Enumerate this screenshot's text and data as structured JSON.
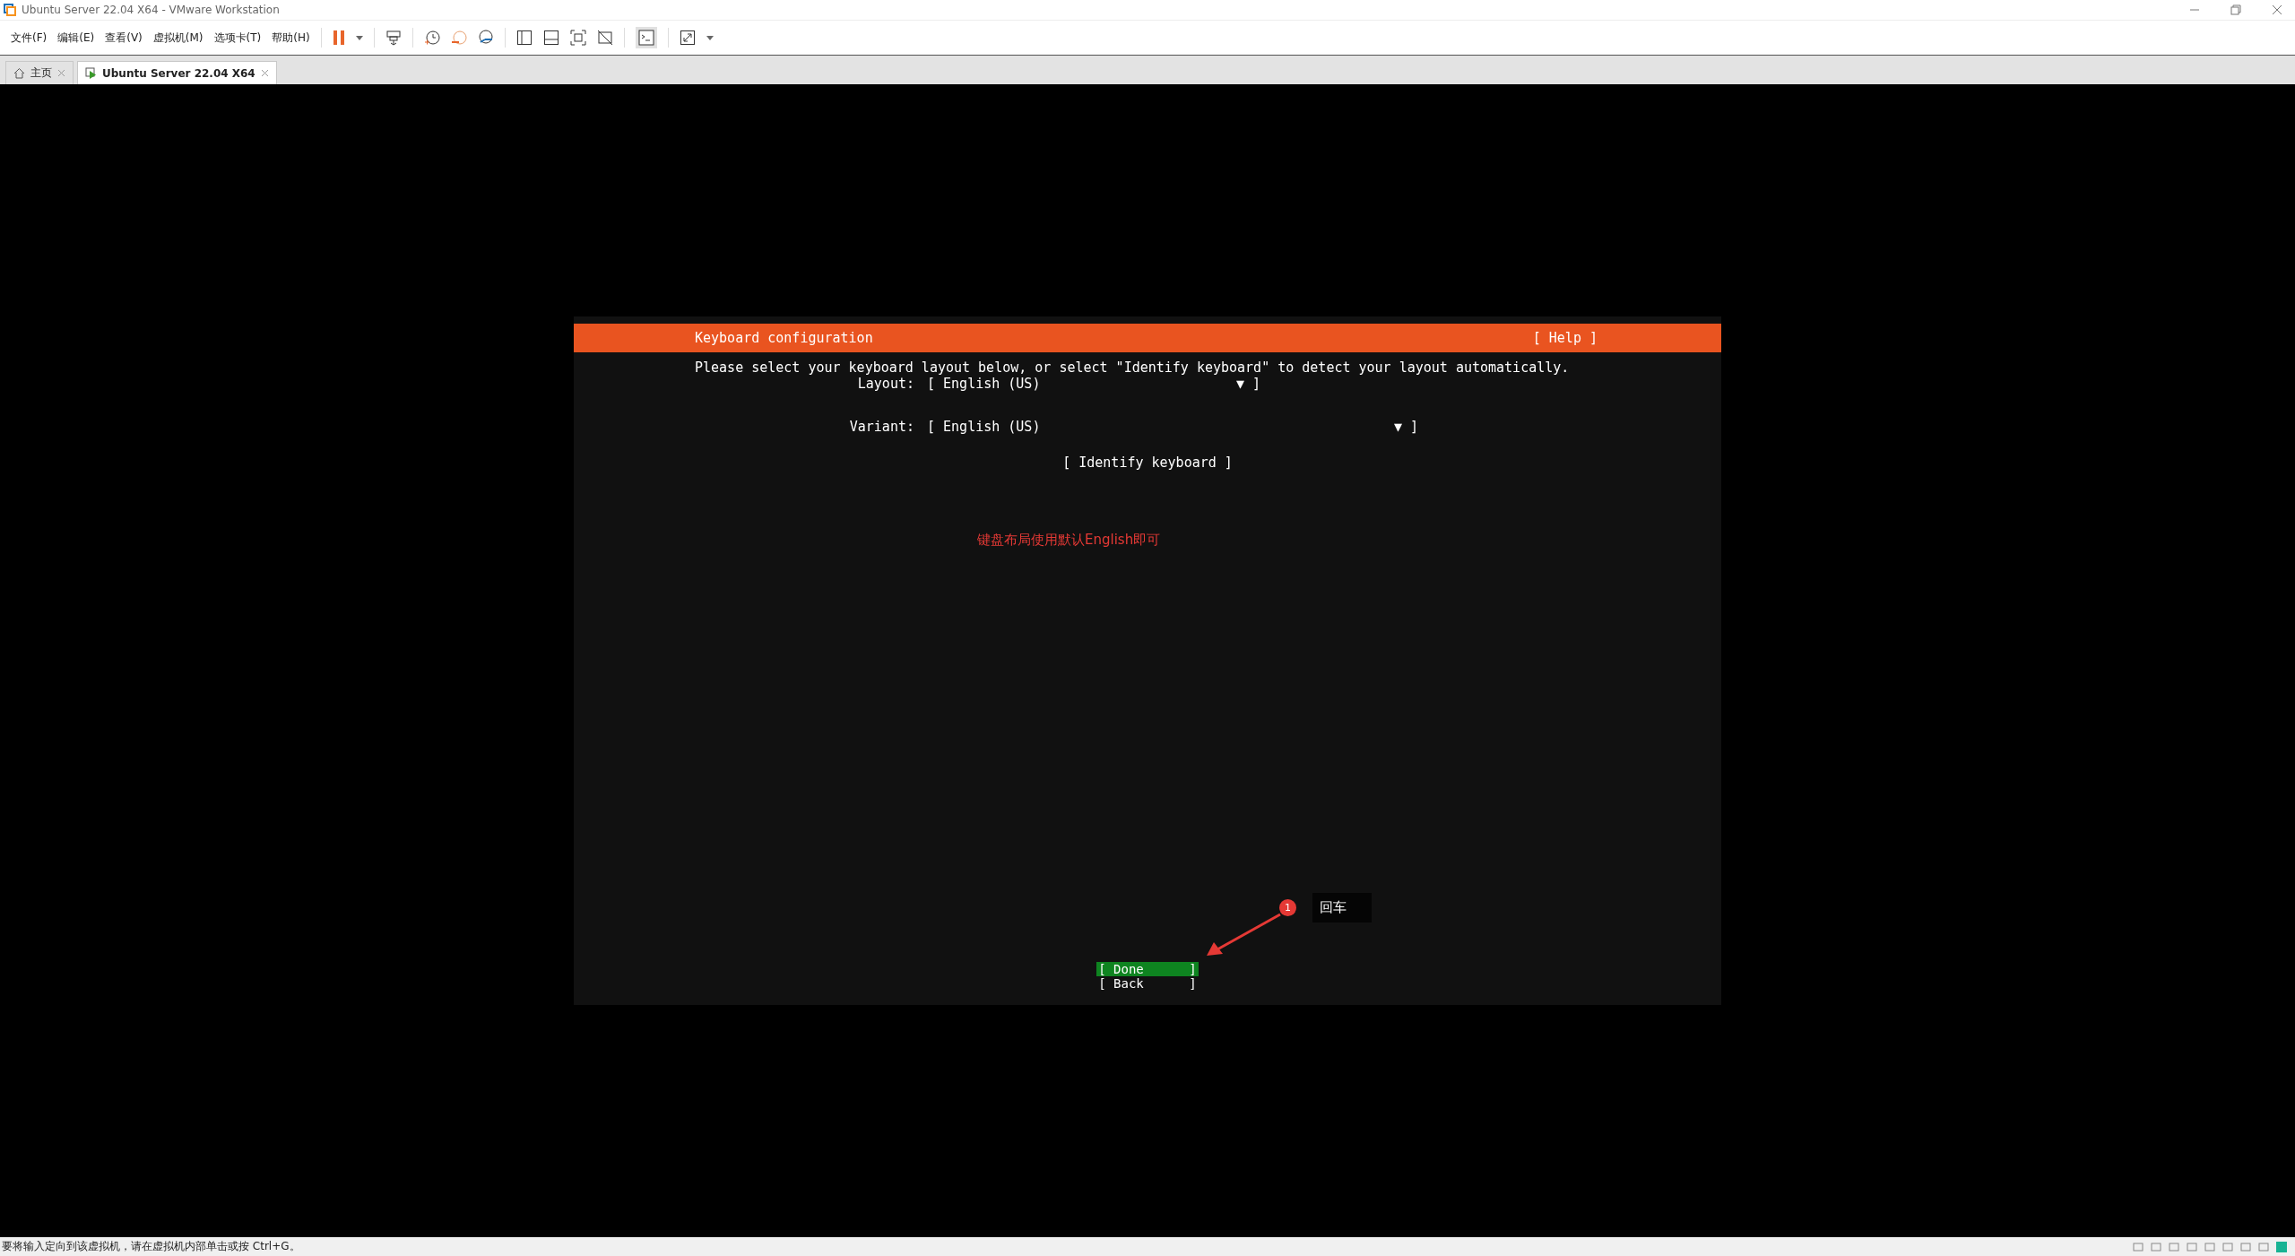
{
  "window": {
    "title": "Ubuntu Server 22.04 X64 - VMware Workstation"
  },
  "menu": [
    "文件(F)",
    "编辑(E)",
    "查看(V)",
    "虚拟机(M)",
    "选项卡(T)",
    "帮助(H)"
  ],
  "tabs": [
    {
      "label": "主页",
      "kind": "home",
      "selected": false
    },
    {
      "label": "Ubuntu Server 22.04 X64",
      "kind": "vm",
      "selected": true
    }
  ],
  "installer": {
    "title": "Keyboard configuration",
    "help": "[ Help ]",
    "instruction": "Please select your keyboard layout below, or select \"Identify keyboard\" to detect your layout automatically.",
    "fields": [
      {
        "label": "Layout:",
        "value": "[ English (US)",
        "arrow": "▼ ]"
      },
      {
        "label": "Variant:",
        "value": "[ English (US)",
        "arrow": "▼ ]"
      }
    ],
    "identify_button": "[ Identify keyboard ]",
    "buttons": [
      {
        "label": "[ Done      ]",
        "selected": true
      },
      {
        "label": "[ Back      ]",
        "selected": false
      }
    ]
  },
  "annotation": {
    "note": "键盘布局使用默认English即可",
    "step_number": "1",
    "step_label": "回车"
  },
  "status_bar": {
    "text": "要将输入定向到该虚拟机，请在虚拟机内部单击或按 Ctrl+G。"
  }
}
